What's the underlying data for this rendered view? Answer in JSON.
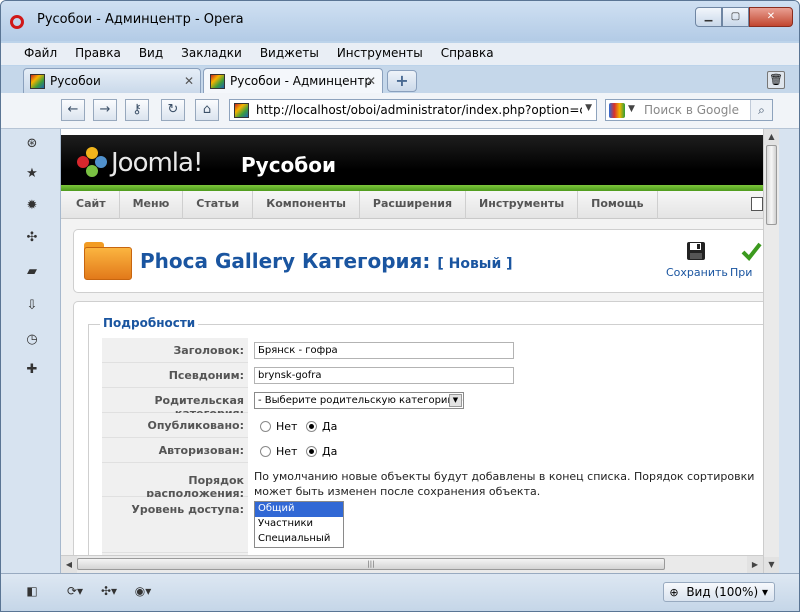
{
  "window": {
    "title": "Русобои - Админцентр - Opera",
    "minimize": "▁",
    "maximize": "▢",
    "close": "✕"
  },
  "menu": [
    "Файл",
    "Правка",
    "Вид",
    "Закладки",
    "Виджеты",
    "Инструменты",
    "Справка"
  ],
  "tabs": [
    {
      "label": "Русобои",
      "close": "✕"
    },
    {
      "label": "Русобои - Админцентр",
      "close": "✕"
    }
  ],
  "tabbar": {
    "new_tab": "+"
  },
  "address": {
    "url": "http://localhost/oboi/administrator/index.php?option=com_p",
    "search_placeholder": "Поиск в Google"
  },
  "nav": {
    "back": "←",
    "forward": "→",
    "key": "⚷",
    "reload": "↻",
    "home": "⌂"
  },
  "joomla": {
    "wordmark": "Joomla!",
    "site_name": "Русобои",
    "submenu": [
      "Сайт",
      "Меню",
      "Статьи",
      "Компоненты",
      "Расширения",
      "Инструменты",
      "Помощь"
    ]
  },
  "toolbar": {
    "heading": "Phoca Gallery Категория:",
    "heading_tag": "[ Новый ]",
    "save_label": "Сохранить",
    "apply_label": "При"
  },
  "form": {
    "legend": "Подробности",
    "title_label": "Заголовок:",
    "title_value": "Брянск - гофра",
    "alias_label": "Псевдоним:",
    "alias_value": "brynsk-gofra",
    "parent_label": "Родительская категория:",
    "parent_value": "- Выберите родительскую категорию -",
    "published_label": "Опубликовано:",
    "authorized_label": "Авторизован:",
    "no": "Нет",
    "yes": "Да",
    "order_label": "Порядок расположения:",
    "order_hint": "По умолчанию новые объекты будут добавлены в конец списка. Порядок сортировки может быть изменен после сохранения объекта.",
    "access_label": "Уровень доступа:",
    "access_options": [
      "Общий",
      "Участники",
      "Специальный"
    ]
  },
  "statusbar": {
    "zoom": "Вид (100%)"
  },
  "colors": {
    "joomla_green": "#5fae2a",
    "heading_blue": "#1a55a0",
    "selected_option": "#3168d5"
  }
}
